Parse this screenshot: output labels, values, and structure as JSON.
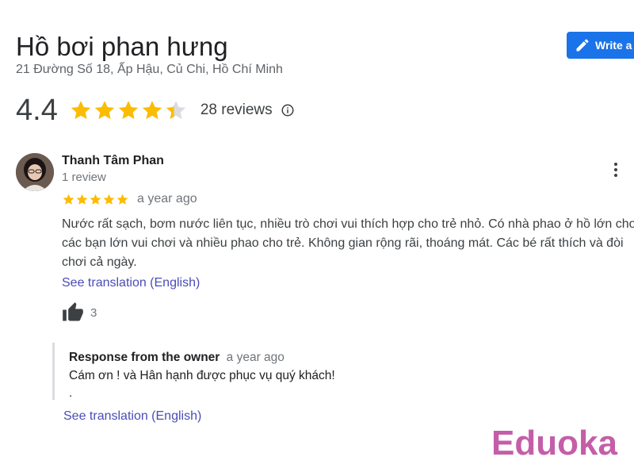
{
  "place": {
    "name": "Hồ bơi phan hưng",
    "address": "21 Đường Số 18, Ấp Hậu, Củ Chi, Hồ Chí Minh"
  },
  "write_review_button": {
    "label": "Write a",
    "icon": "pencil-icon"
  },
  "rating_summary": {
    "value": "4.4",
    "stars": 4.4,
    "review_count": "28 reviews",
    "info_icon": "info-icon"
  },
  "review": {
    "reviewer_name": "Thanh Tâm Phan",
    "reviewer_meta": "1 review",
    "stars": 5,
    "time": "a year ago",
    "text": "Nước rất sạch, bơm nước liên tục, nhiều trò chơi vui thích hợp cho trẻ nhỏ. Có nhà phao ở hồ lớn cho các bạn lớn vui chơi và nhiều phao cho trẻ. Không gian rộng rãi, thoáng mát. Các bé rất thích và đòi chơi cả ngày.",
    "see_translation": "See translation (English)",
    "like_count": "3",
    "more_icon": "more-vert-icon"
  },
  "owner_response": {
    "title": "Response from the owner",
    "time": "a year ago",
    "text": "Cám ơn ! và Hân hạnh được phục vụ quý khách!",
    "trailing": ".",
    "see_translation": "See translation (English)"
  },
  "watermark": {
    "text": "Eduoka"
  },
  "colors": {
    "star": "#fbbc04",
    "star_empty": "#dadce0",
    "button": "#1a73e8",
    "link": "#4a4cb8",
    "watermark": "#c45ea8"
  }
}
